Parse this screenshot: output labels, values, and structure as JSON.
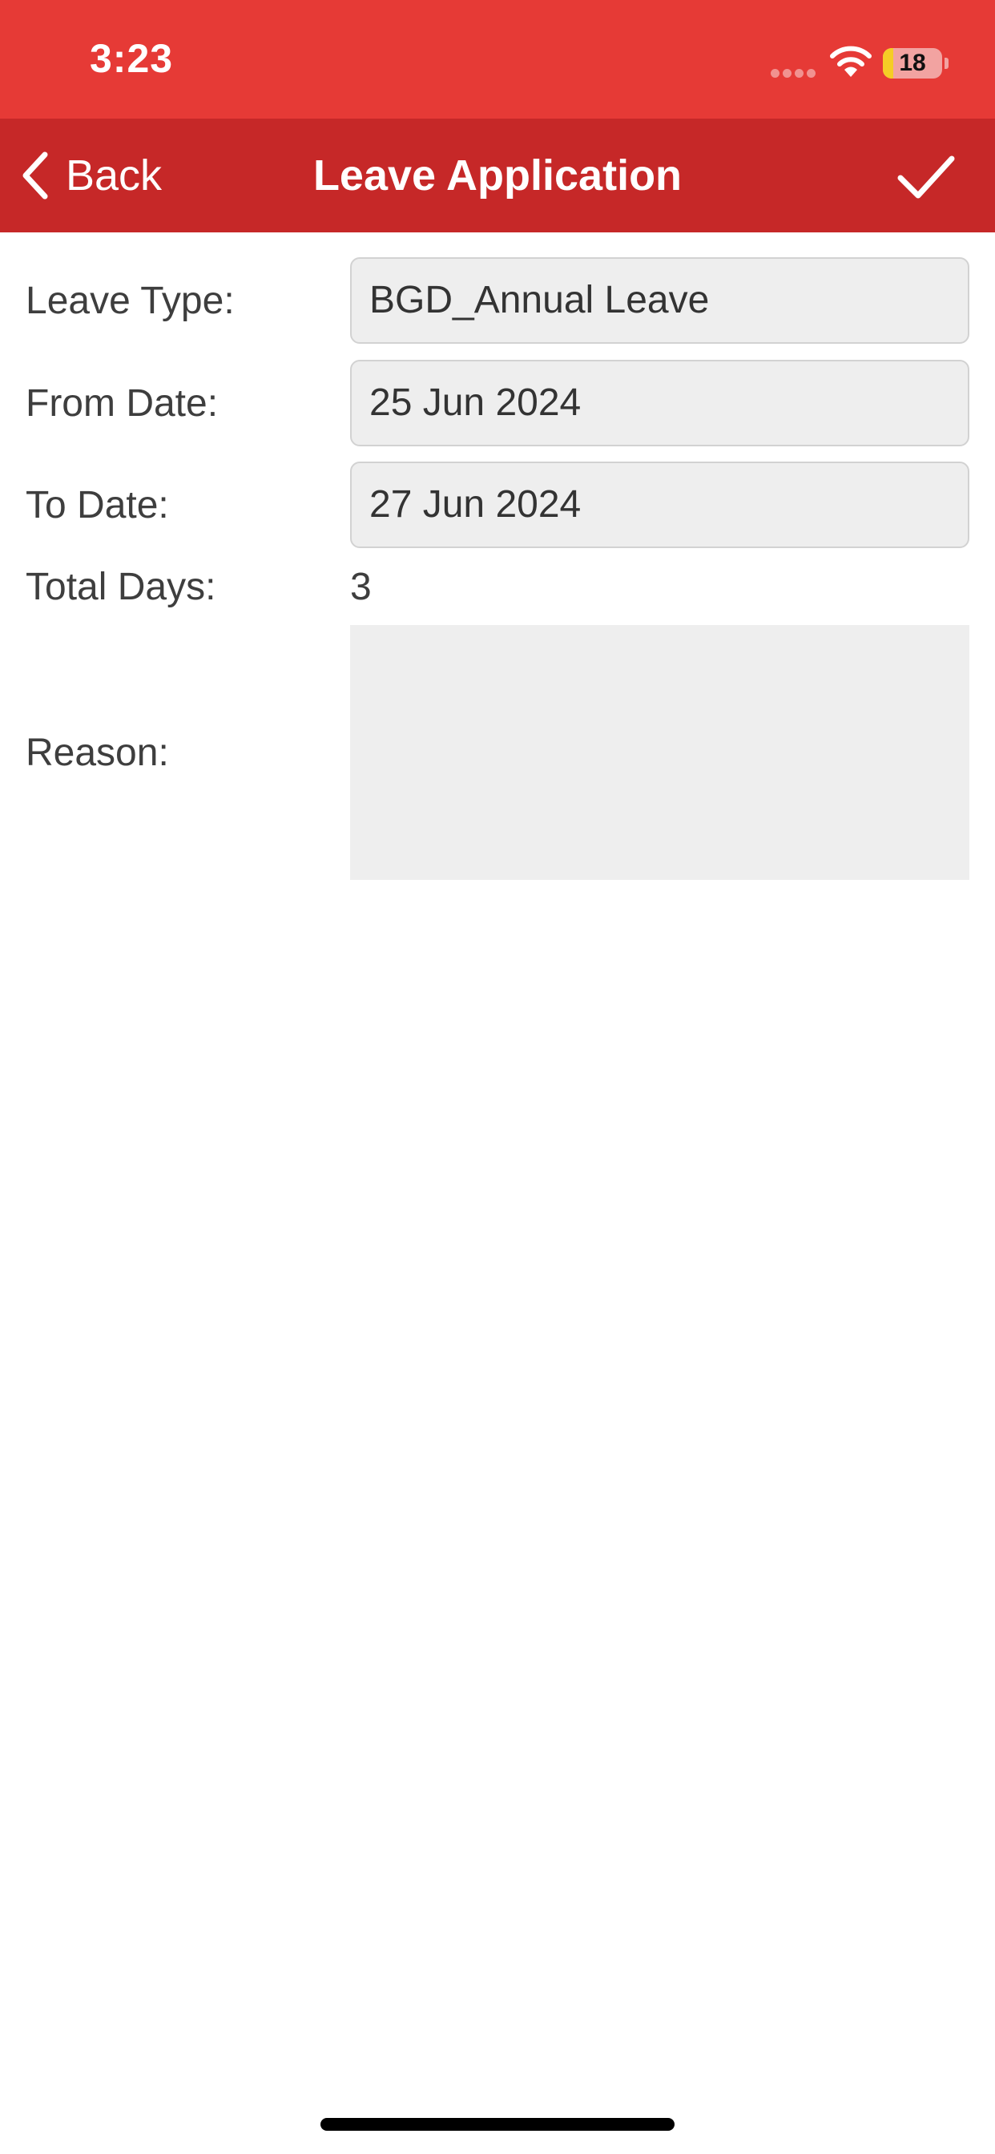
{
  "status_bar": {
    "time": "3:23",
    "battery_level": "18",
    "battery_fraction": 0.18
  },
  "nav": {
    "back_label": "Back",
    "title": "Leave Application",
    "confirm_icon": "checkmark-icon"
  },
  "form": {
    "leave_type": {
      "label": "Leave Type:",
      "value": "BGD_Annual Leave"
    },
    "from_date": {
      "label": "From Date:",
      "value": "25 Jun 2024"
    },
    "to_date": {
      "label": "To Date:",
      "value": "27 Jun 2024"
    },
    "total_days": {
      "label": "Total Days:",
      "value": "3"
    },
    "reason": {
      "label": "Reason:",
      "value": ""
    }
  },
  "colors": {
    "status_bar": "#e63a36",
    "nav_bar": "#c62828",
    "field_background": "#eeeeee",
    "battery_fill": "#f5cd26"
  }
}
